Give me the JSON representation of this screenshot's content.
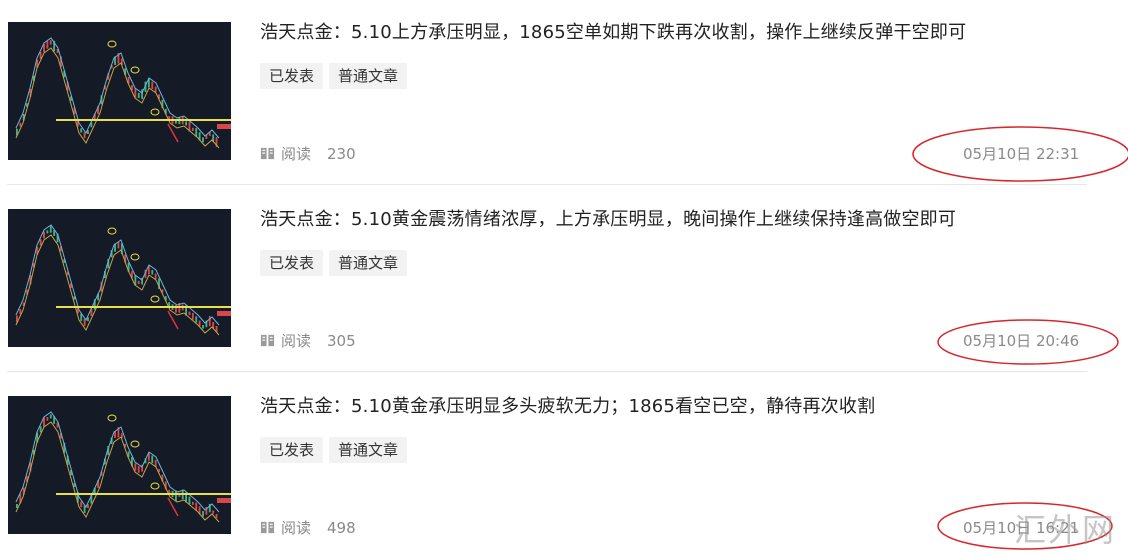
{
  "articles": [
    {
      "title": "浩天点金：5.10上方承压明显，1865空单如期下跌再次收割，操作上继续反弹干空即可",
      "tags": [
        "已发表",
        "普通文章"
      ],
      "read_label": "阅读",
      "read_count": "230",
      "date": "05月10日 22:31"
    },
    {
      "title": "浩天点金：5.10黄金震荡情绪浓厚，上方承压明显，晚间操作上继续保持逢高做空即可",
      "tags": [
        "已发表",
        "普通文章"
      ],
      "read_label": "阅读",
      "read_count": "305",
      "date": "05月10日 20:46"
    },
    {
      "title": "浩天点金：5.10黄金承压明显多头疲软无力；1865看空已空，静待再次收割",
      "tags": [
        "已发表",
        "普通文章"
      ],
      "read_label": "阅读",
      "read_count": "498",
      "date": "05月10日 16:21"
    }
  ],
  "watermark": "汇外网",
  "colors": {
    "annotation_circle": "#d9252a",
    "chart_bg": "#141a26",
    "support_line": "#e8e04a"
  }
}
